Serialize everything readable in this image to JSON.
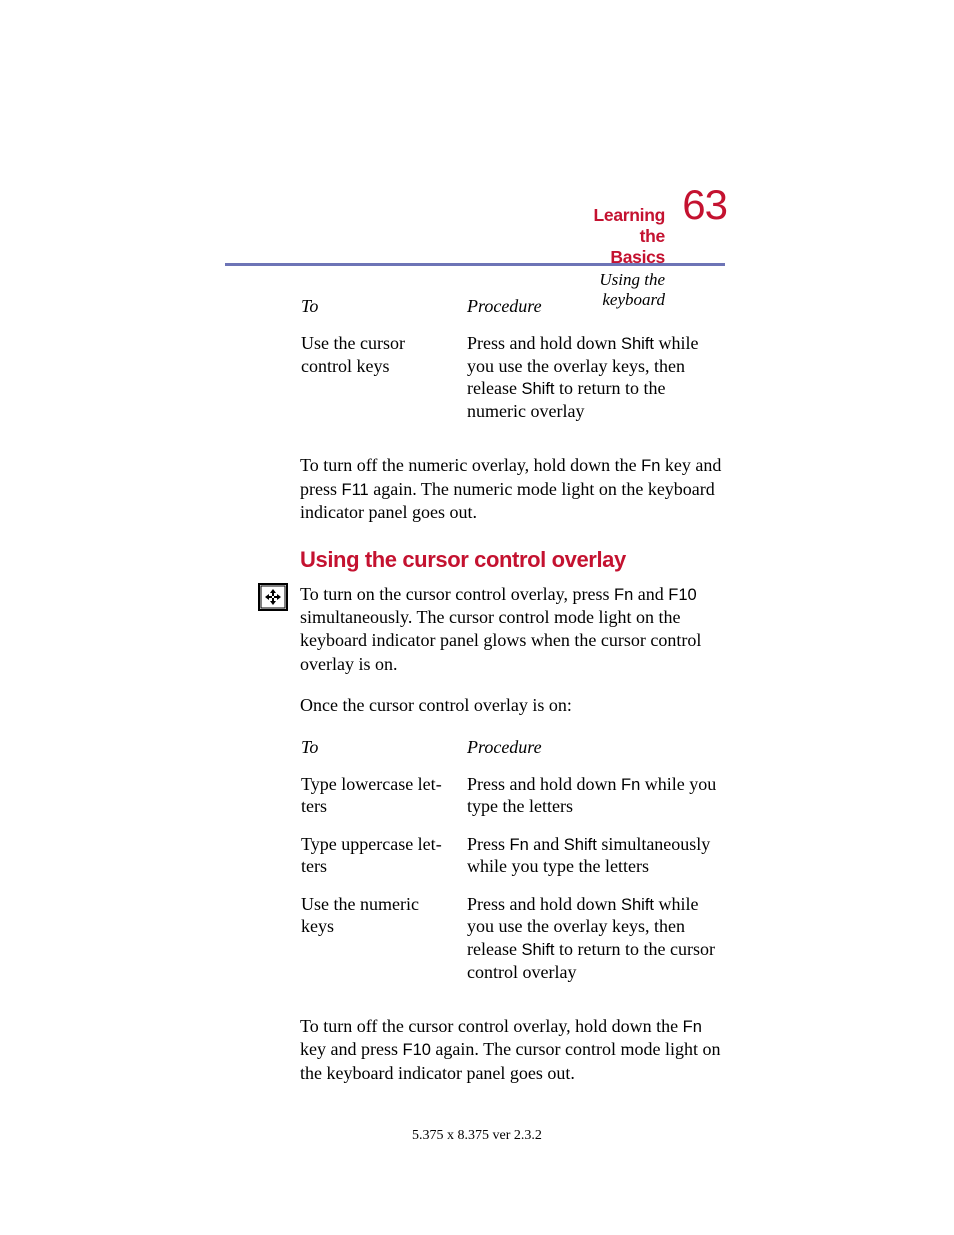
{
  "header": {
    "chapter": "Learning the Basics",
    "section": "Using the keyboard",
    "page_number": "63"
  },
  "table1": {
    "head_to": "To",
    "head_proc": "Procedure",
    "rows": [
      {
        "to": "Use the cursor control keys",
        "proc_parts": [
          "Press and hold down ",
          "Shift",
          " while you use the overlay keys, then release ",
          "Shift",
          " to return to the numeric overlay"
        ]
      }
    ]
  },
  "para1_parts": [
    "To turn off the numeric overlay, hold down the ",
    "Fn",
    " key and press ",
    "F11",
    " again. The numeric mode light on the keyboard indicator panel goes out."
  ],
  "heading2": "Using the cursor control overlay",
  "para2_parts": [
    "To turn on the cursor control overlay, press ",
    "Fn",
    " and ",
    "F10",
    " simultaneously. The cursor control mode light on the keyboard indicator panel glows when the cursor control overlay is on."
  ],
  "para3": "Once the cursor control overlay is on:",
  "table2": {
    "head_to": "To",
    "head_proc": "Procedure",
    "rows": [
      {
        "to": "Type lowercase let­ters",
        "proc_parts": [
          "Press and hold down ",
          "Fn",
          " while you type the letters"
        ]
      },
      {
        "to": "Type uppercase let­ters",
        "proc_parts": [
          "Press ",
          "Fn",
          " and ",
          "Shift",
          " simultaneously while you type the letters"
        ]
      },
      {
        "to": "Use the numeric keys",
        "proc_parts": [
          "Press and hold down ",
          "Shift",
          " while you use the overlay keys, then release ",
          "Shift",
          " to return to the cursor control overlay"
        ]
      }
    ]
  },
  "para4_parts": [
    "To turn off the cursor control overlay, hold down the ",
    "Fn",
    " key and press ",
    "F10",
    " again. The cursor control mode light on the keyboard indicator panel goes out."
  ],
  "footer": "5.375 x 8.375 ver 2.3.2"
}
